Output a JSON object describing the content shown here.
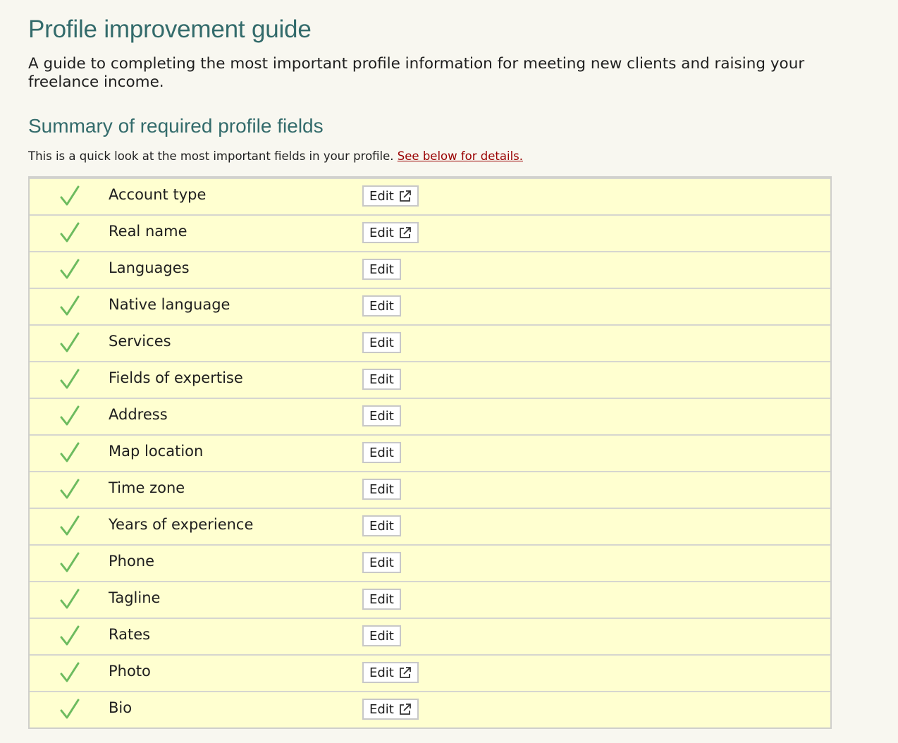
{
  "header": {
    "title": "Profile improvement guide",
    "intro": "A guide to completing the most important profile information for meeting new clients and raising your freelance income."
  },
  "summary": {
    "title": "Summary of required profile fields",
    "note": "This is a quick look at the most important fields in your profile.",
    "details_link": "See below for details."
  },
  "colors": {
    "heading": "#336b6b",
    "check": "#6dbb5f",
    "row_background": "#ffffd0",
    "link": "#990000"
  },
  "fields": [
    {
      "label": "Account type",
      "status": "complete",
      "edit_label": "Edit",
      "external": true
    },
    {
      "label": "Real name",
      "status": "complete",
      "edit_label": "Edit",
      "external": true
    },
    {
      "label": "Languages",
      "status": "complete",
      "edit_label": "Edit",
      "external": false
    },
    {
      "label": "Native language",
      "status": "complete",
      "edit_label": "Edit",
      "external": false
    },
    {
      "label": "Services",
      "status": "complete",
      "edit_label": "Edit",
      "external": false
    },
    {
      "label": "Fields of expertise",
      "status": "complete",
      "edit_label": "Edit",
      "external": false
    },
    {
      "label": "Address",
      "status": "complete",
      "edit_label": "Edit",
      "external": false
    },
    {
      "label": "Map location",
      "status": "complete",
      "edit_label": "Edit",
      "external": false
    },
    {
      "label": "Time zone",
      "status": "complete",
      "edit_label": "Edit",
      "external": false
    },
    {
      "label": "Years of experience",
      "status": "complete",
      "edit_label": "Edit",
      "external": false
    },
    {
      "label": "Phone",
      "status": "complete",
      "edit_label": "Edit",
      "external": false
    },
    {
      "label": "Tagline",
      "status": "complete",
      "edit_label": "Edit",
      "external": false
    },
    {
      "label": "Rates",
      "status": "complete",
      "edit_label": "Edit",
      "external": false
    },
    {
      "label": "Photo",
      "status": "complete",
      "edit_label": "Edit",
      "external": true
    },
    {
      "label": "Bio",
      "status": "complete",
      "edit_label": "Edit",
      "external": true
    }
  ]
}
